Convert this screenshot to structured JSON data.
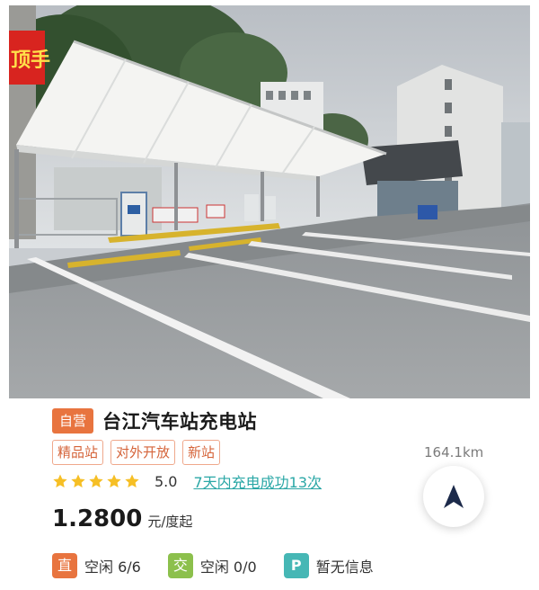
{
  "station": {
    "self_badge": "自营",
    "name": "台江汽车站充电站",
    "tags": [
      "精品站",
      "对外开放",
      "新站"
    ],
    "distance": "164.1km",
    "rating": {
      "stars": 5,
      "score": "5.0",
      "success_text": "7天内充电成功13次"
    },
    "price": {
      "amount": "1.2800",
      "unit": "元/度起"
    },
    "chargers": {
      "dc": {
        "badge": "直",
        "status": "空闲 6/6"
      },
      "ac": {
        "badge": "交",
        "status": "空闲 0/0"
      },
      "parking": {
        "badge": "P",
        "status": "暂无信息"
      }
    }
  },
  "photo": {
    "banner_text": "顶手"
  },
  "colors": {
    "accent_orange": "#e8743f",
    "tag_border": "#efa88c",
    "link_teal": "#2aa7a6",
    "ac_green": "#8cc04c",
    "parking_teal": "#46b7b5",
    "star_yellow": "#f6bf25",
    "nav_arrow": "#1c2a4a"
  },
  "icons": {
    "star": "star-icon",
    "navigate": "navigation-arrow-icon"
  }
}
